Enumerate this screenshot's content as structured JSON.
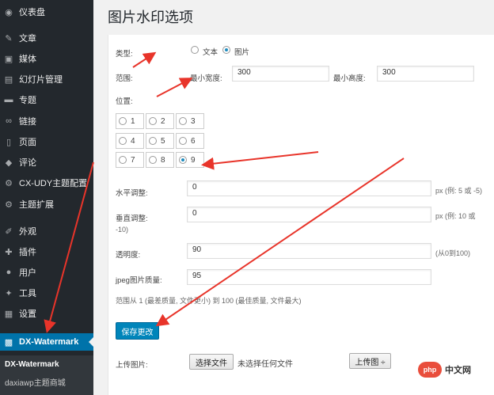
{
  "sidebar": {
    "items": [
      {
        "label": "仪表盘",
        "icon": "dashboard-icon",
        "glyph": "◉"
      },
      {
        "label": "文章",
        "icon": "pin-icon",
        "glyph": "✎"
      },
      {
        "label": "媒体",
        "icon": "media-icon",
        "glyph": "▣"
      },
      {
        "label": "幻灯片管理",
        "icon": "slides-icon",
        "glyph": "▤"
      },
      {
        "label": "专题",
        "icon": "topic-icon",
        "glyph": "▬"
      },
      {
        "label": "链接",
        "icon": "link-icon",
        "glyph": "∞"
      },
      {
        "label": "页面",
        "icon": "page-icon",
        "glyph": "▯"
      },
      {
        "label": "评论",
        "icon": "comment-icon",
        "glyph": "◆"
      },
      {
        "label": "CX-UDY主题配置",
        "icon": "gear-icon",
        "glyph": "⚙"
      },
      {
        "label": "主题扩展",
        "icon": "gear-icon",
        "glyph": "⚙"
      },
      {
        "label": "外观",
        "icon": "brush-icon",
        "glyph": "✐"
      },
      {
        "label": "插件",
        "icon": "plugin-icon",
        "glyph": "✚"
      },
      {
        "label": "用户",
        "icon": "user-icon",
        "glyph": "●"
      },
      {
        "label": "工具",
        "icon": "wrench-icon",
        "glyph": "✦"
      },
      {
        "label": "设置",
        "icon": "settings-icon",
        "glyph": "▦"
      },
      {
        "label": "DX-Watermark",
        "icon": "watermark-icon",
        "glyph": "▩"
      }
    ],
    "submenu": [
      "DX-Watermark",
      "daxiawp主题商城"
    ]
  },
  "page": {
    "title": "图片水印选项"
  },
  "form": {
    "type_label": "类型:",
    "type_text": "文本",
    "type_image": "图片",
    "range_label": "范围:",
    "min_width_label": "最小宽度:",
    "min_width": "300",
    "min_height_label": "最小高度:",
    "min_height": "300",
    "position_label": "位置:",
    "positions": [
      "1",
      "2",
      "3",
      "4",
      "5",
      "6",
      "7",
      "8",
      "9"
    ],
    "selected_position": "9",
    "h_offset_label": "水平调整:",
    "h_offset": "0",
    "h_hint": "px (例: 5 或 -5)",
    "v_offset_label": "垂直调整:",
    "v_offset": "0",
    "v_hint": "px (例: 10 或",
    "v_hint2": "-10)",
    "opacity_label": "透明度:",
    "opacity": "90",
    "opacity_hint": "(从0到100)",
    "jpeg_label": "jpeg图片质量:",
    "jpeg": "95",
    "jpeg_hint": "范围从 1 (最差质量, 文件更小) 到 100 (最佳质量, 文件最大)",
    "save": "保存更改",
    "upload_label": "上传图片:",
    "choose_file": "选择文件",
    "no_file": "未选择任何文件",
    "upload_button": "上传图 ÷"
  },
  "watermark": {
    "logo": "php",
    "text": "中文网"
  },
  "colors": {
    "sidebar": "#23282d",
    "active": "#0073aa",
    "arrow": "#e8342a",
    "button": "#0085ba"
  }
}
